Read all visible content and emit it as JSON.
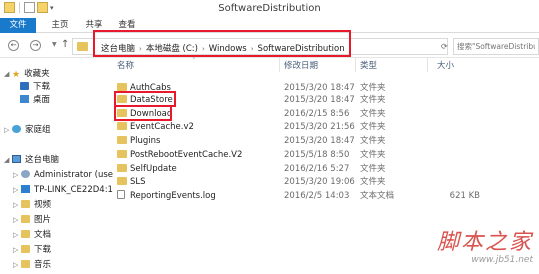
{
  "window": {
    "title": "SoftwareDistribution"
  },
  "ribbon": {
    "tabs": [
      "文件",
      "主页",
      "共享",
      "查看"
    ]
  },
  "address": {
    "crumbs": [
      "这台电脑",
      "本地磁盘 (C:)",
      "Windows",
      "SoftwareDistribution"
    ],
    "search_placeholder": "搜索\"SoftwareDistributi"
  },
  "nav": {
    "items": [
      {
        "label": "收藏夹",
        "icon": "star-icon"
      },
      {
        "label": "下载",
        "icon": "download-folder-icon"
      },
      {
        "label": "桌面",
        "icon": "desktop-icon"
      },
      {
        "label": "家庭组",
        "icon": "homegroup-icon"
      },
      {
        "label": "这台电脑",
        "icon": "computer-icon"
      },
      {
        "label": "Administrator (use",
        "icon": "user-icon"
      },
      {
        "label": "TP-LINK_CE22D4:1",
        "icon": "network-drive-icon"
      },
      {
        "label": "视频",
        "icon": "folder-icon"
      },
      {
        "label": "图片",
        "icon": "folder-icon"
      },
      {
        "label": "文档",
        "icon": "folder-icon"
      },
      {
        "label": "下载",
        "icon": "folder-icon"
      },
      {
        "label": "音乐",
        "icon": "folder-icon"
      }
    ]
  },
  "columns": {
    "name": "名称",
    "date": "修改日期",
    "type": "类型",
    "size": "大小"
  },
  "files": [
    {
      "name": "AuthCabs",
      "date": "2015/3/20 18:47",
      "type": "文件夹",
      "size": "",
      "icon": "folder-icon"
    },
    {
      "name": "DataStore",
      "date": "2015/3/20 18:47",
      "type": "文件夹",
      "size": "",
      "icon": "folder-icon"
    },
    {
      "name": "Download",
      "date": "2016/2/15 8:56",
      "type": "文件夹",
      "size": "",
      "icon": "folder-icon"
    },
    {
      "name": "EventCache.v2",
      "date": "2015/3/20 21:56",
      "type": "文件夹",
      "size": "",
      "icon": "folder-icon"
    },
    {
      "name": "Plugins",
      "date": "2015/3/20 18:47",
      "type": "文件夹",
      "size": "",
      "icon": "folder-icon"
    },
    {
      "name": "PostRebootEventCache.V2",
      "date": "2015/5/18 8:50",
      "type": "文件夹",
      "size": "",
      "icon": "folder-icon"
    },
    {
      "name": "SelfUpdate",
      "date": "2016/2/16 5:27",
      "type": "文件夹",
      "size": "",
      "icon": "folder-icon"
    },
    {
      "name": "SLS",
      "date": "2015/3/20 19:06",
      "type": "文件夹",
      "size": "",
      "icon": "folder-icon"
    },
    {
      "name": "ReportingEvents.log",
      "date": "2016/2/5 14:03",
      "type": "文本文档",
      "size": "621 KB",
      "icon": "text-file-icon"
    }
  ],
  "watermark": {
    "text": "脚本之家",
    "url": "www.jb51.net"
  },
  "colors": {
    "accent": "#1979ca",
    "highlight": "#e8192c",
    "folder": "#e6c35c"
  }
}
